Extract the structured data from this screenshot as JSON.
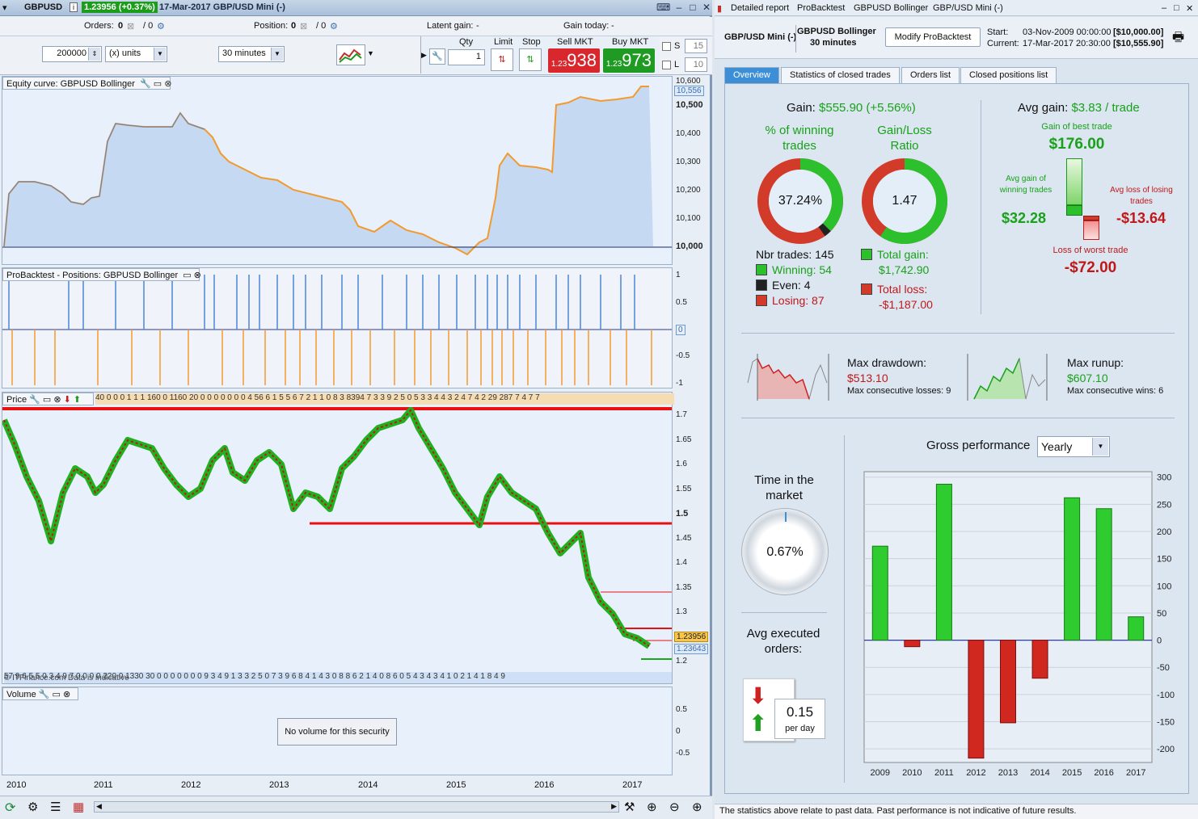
{
  "window": {
    "symbol": "GBPUSD",
    "price_badge": "1.23956 (+0.37%)",
    "title": "17-Mar-2017 GBP/USD Mini (-)"
  },
  "orderbar": {
    "orders_label": "Orders:",
    "orders_value": "0",
    "orders_sep": "/ 0",
    "position_label": "Position:",
    "position_value": "0",
    "position_sep": "/ 0",
    "latent_label": "Latent gain:",
    "latent_value": "-",
    "gain_today_label": "Gain today:",
    "gain_today_value": "-"
  },
  "tradebar": {
    "units_value": "200000",
    "units_mode": "(x) units",
    "timeframe": "30 minutes",
    "qty_label": "Qty",
    "qty_value": "1",
    "limit_label": "Limit",
    "stop_label": "Stop",
    "sell_label": "Sell MKT",
    "sell_small": "1.23",
    "sell_big": "938",
    "buy_label": "Buy MKT",
    "buy_small": "1.23",
    "buy_big": "973",
    "s_label": "S",
    "s_value": "15",
    "l_label": "L",
    "l_value": "10"
  },
  "equity": {
    "title": "Equity curve: GBPUSD Bollinger",
    "axis": [
      "10,600",
      "10,500",
      "10,400",
      "10,300",
      "10,200",
      "10,100",
      "10,000"
    ],
    "current": "10,556"
  },
  "positions": {
    "title": "ProBacktest - Positions: GBPUSD Bollinger",
    "axis": [
      "1",
      "0.5",
      "0",
      "-0.5",
      "-1"
    ]
  },
  "price": {
    "title": "Price",
    "top_ticks": "40 0 0 0 1 1 1 160 0 1160 20 0 0 0 0 0 0 0 4 56 6 1 5 5 6 7 2 1 1 0 8 3 8394 7 3 3 9 2 5 0 5 3 3 4 4 3 2 4 7 4 2 29 287 7 4 7 7",
    "bottom_ticks": "57 9 6 5 5 0 3 4 9 7 0 0 0 0 220 0 1330 30 0 0 0 0 0 0 0 9 3 4 9 1 3 3 2 5 0 7 3 9 6 8 4 1 4 3 0 8 8 6 2 1 4 0 8 6 0 5 4 3 4 3 4 1 0 2 1 4 1 8 4 9",
    "watermark": "© ITFinance.com Data is indicative",
    "axis": [
      "1.7",
      "1.65",
      "1.6",
      "1.55",
      "1.5",
      "1.45",
      "1.4",
      "1.35",
      "1.3",
      "1.25",
      "1.2"
    ],
    "last_price": "1.23956",
    "bid_price": "1.23643"
  },
  "volume": {
    "title": "Volume",
    "message": "No volume for this security",
    "axis": [
      "0.5",
      "0",
      "-0.5"
    ]
  },
  "xaxis": [
    "2010",
    "2011",
    "2012",
    "2013",
    "2014",
    "2015",
    "2016",
    "2017"
  ],
  "right": {
    "titlebar": [
      "Detailed report",
      "ProBacktest",
      "GBPUSD Bollinger",
      "GBP/USD Mini (-)"
    ],
    "instrument": "GBP/USD Mini (-)",
    "system_name": "GBPUSD Bollinger",
    "system_tf": "30 minutes",
    "modify_button": "Modify ProBacktest",
    "start_label": "Start:",
    "start_date": "03-Nov-2009 00:00:00",
    "start_value": "[$10,000.00]",
    "current_label": "Current:",
    "current_date": "17-Mar-2017 20:30:00",
    "current_value": "[$10,555.90]",
    "tabs": [
      "Overview",
      "Statistics of closed trades",
      "Orders list",
      "Closed positions list"
    ],
    "gain_label": "Gain:",
    "gain_value": "$555.90 (+5.56%)",
    "pct_win_title": "% of winning trades",
    "pct_win": "37.24%",
    "gl_title": "Gain/Loss Ratio",
    "gl_ratio": "1.47",
    "nbr_trades": "Nbr trades: 145",
    "winning": "Winning: 54",
    "even": "Even: 4",
    "losing": "Losing: 87",
    "total_gain_label": "Total gain:",
    "total_gain": "$1,742.90",
    "total_loss_label": "Total loss:",
    "total_loss": "-$1,187.00",
    "avg_gain_label": "Avg gain:",
    "avg_gain": "$3.83 / trade",
    "best_label": "Gain of best trade",
    "best_value": "$176.00",
    "avg_win_label": "Avg gain of winning trades",
    "avg_win": "$32.28",
    "avg_loss_label": "Avg loss of losing trades",
    "avg_loss": "-$13.64",
    "worst_label": "Loss of worst trade",
    "worst_value": "-$72.00",
    "drawdown_label": "Max drawdown:",
    "drawdown_value": "$513.10",
    "consec_losses": "Max consecutive losses: 9",
    "runup_label": "Max runup:",
    "runup_value": "$607.10",
    "consec_wins": "Max consecutive wins: 6",
    "time_market_label": "Time in the market",
    "time_market": "0.67%",
    "avg_orders_label": "Avg executed orders:",
    "avg_orders": "0.15",
    "per_day": "per day",
    "gross_label": "Gross performance",
    "gross_period": "Yearly",
    "footer": "The statistics above relate to past data. Past performance is not indicative of future results."
  },
  "colors": {
    "gain_green": "#19a119",
    "loss_red": "#c01818",
    "accent_blue": "#3c8fd6"
  },
  "chart_data": {
    "type": "bar",
    "title": "Gross performance",
    "categories": [
      "2009",
      "2010",
      "2011",
      "2012",
      "2013",
      "2014",
      "2015",
      "2016",
      "2017"
    ],
    "values": [
      173,
      -12,
      287,
      -217,
      -152,
      -70,
      262,
      242,
      43
    ],
    "ylim": [
      -225,
      310
    ],
    "yticks": [
      300,
      250,
      200,
      150,
      100,
      50,
      0,
      -50,
      -100,
      -150,
      -200
    ]
  }
}
